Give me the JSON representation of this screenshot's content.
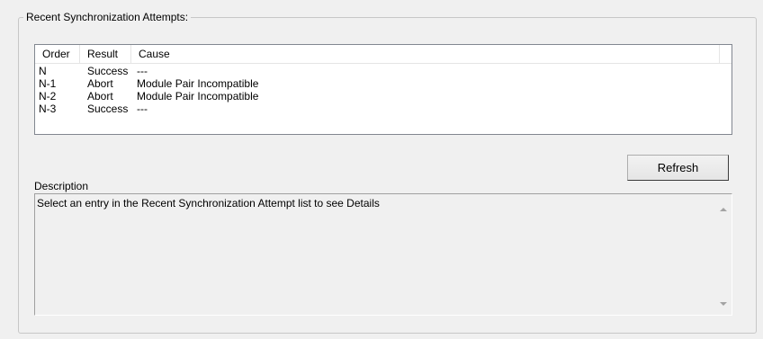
{
  "group": {
    "title": "Recent Synchronization Attempts:"
  },
  "list": {
    "columns": {
      "order": "Order",
      "result": "Result",
      "cause": "Cause"
    },
    "rows": [
      {
        "order": "N",
        "result": "Success",
        "cause": "---"
      },
      {
        "order": "N-1",
        "result": "Abort",
        "cause": "Module Pair Incompatible"
      },
      {
        "order": "N-2",
        "result": "Abort",
        "cause": "Module Pair Incompatible"
      },
      {
        "order": "N-3",
        "result": "Success",
        "cause": "---"
      }
    ]
  },
  "refresh_label": "Refresh",
  "description": {
    "label": "Description",
    "text": "Select an entry in the Recent Synchronization Attempt list to see Details",
    "scroll_up_icon": "scroll-up-arrow",
    "scroll_down_icon": "scroll-down-arrow"
  }
}
